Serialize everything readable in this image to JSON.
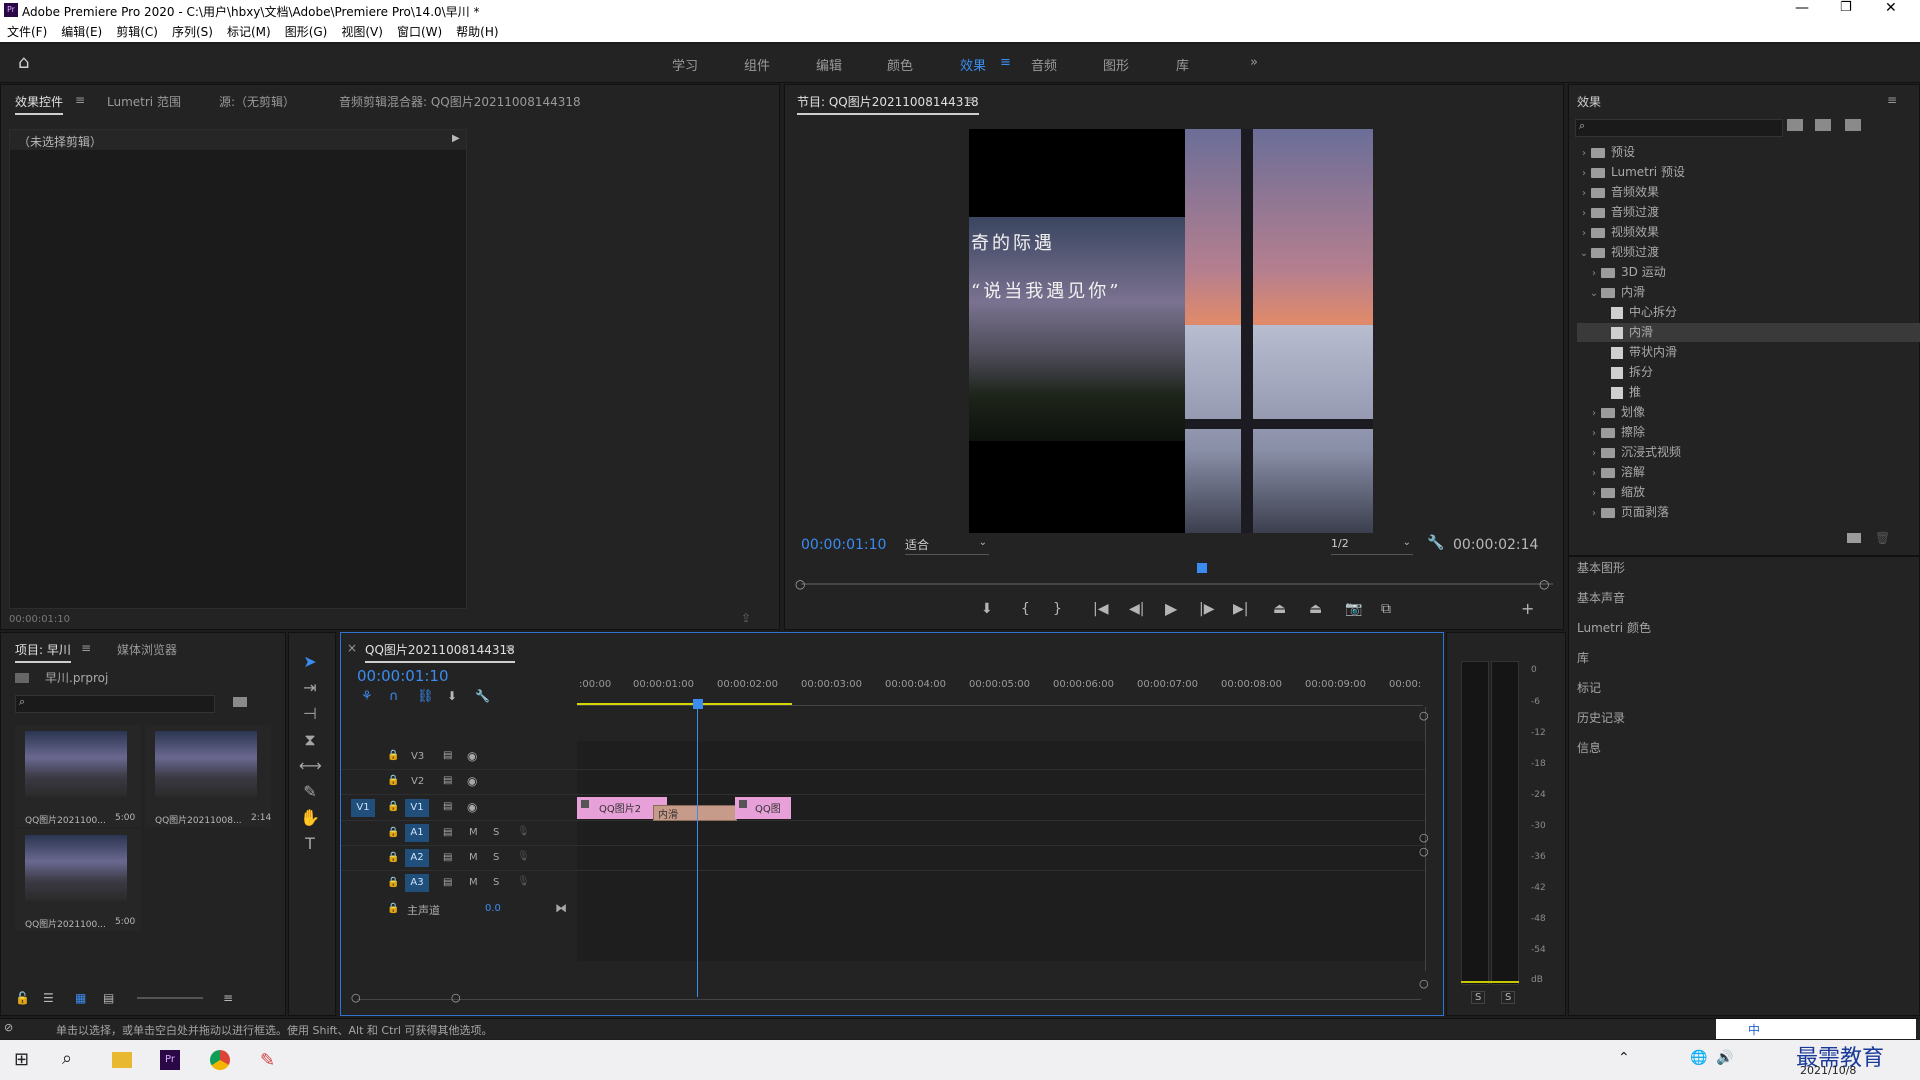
{
  "window": {
    "title": "Adobe Premiere Pro 2020 - C:\\用户\\hbxy\\文档\\Adobe\\Premiere Pro\\14.0\\早川 *"
  },
  "menu": [
    "文件(F)",
    "编辑(E)",
    "剪辑(C)",
    "序列(S)",
    "标记(M)",
    "图形(G)",
    "视图(V)",
    "窗口(W)",
    "帮助(H)"
  ],
  "workspaces": [
    {
      "label": "学习"
    },
    {
      "label": "组件"
    },
    {
      "label": "编辑"
    },
    {
      "label": "颜色"
    },
    {
      "label": "效果",
      "active": true
    },
    {
      "label": "音频"
    },
    {
      "label": "图形"
    },
    {
      "label": "库"
    }
  ],
  "top_left_panel": {
    "tabs": [
      "效果控件",
      "Lumetri 范围",
      "源:（无剪辑）",
      "音频剪辑混合器: QQ图片20211008144318"
    ],
    "no_clip": "（未选择剪辑）",
    "timecode": "00:00:01:10"
  },
  "program": {
    "title": "节目: QQ图片20211008144318",
    "overlay_line1": "奇的际遇",
    "overlay_line2": "“说当我遇见你”",
    "timecode": "00:00:01:10",
    "fit": "适合",
    "quality": "1/2",
    "duration": "00:00:02:14"
  },
  "effects": {
    "title": "效果",
    "tree": [
      {
        "label": "预设",
        "type": "folder",
        "level": 0,
        "open": false
      },
      {
        "label": "Lumetri 预设",
        "type": "folder",
        "level": 0,
        "open": false
      },
      {
        "label": "音频效果",
        "type": "folder",
        "level": 0,
        "open": false
      },
      {
        "label": "音频过渡",
        "type": "folder",
        "level": 0,
        "open": false
      },
      {
        "label": "视频效果",
        "type": "folder",
        "level": 0,
        "open": false
      },
      {
        "label": "视频过渡",
        "type": "folder",
        "level": 0,
        "open": true
      },
      {
        "label": "3D 运动",
        "type": "folder",
        "level": 1,
        "open": false
      },
      {
        "label": "内滑",
        "type": "folder",
        "level": 1,
        "open": true
      },
      {
        "label": "中心拆分",
        "type": "fx",
        "level": 2
      },
      {
        "label": "内滑",
        "type": "fx",
        "level": 2,
        "selected": true
      },
      {
        "label": "带状内滑",
        "type": "fx",
        "level": 2
      },
      {
        "label": "拆分",
        "type": "fx",
        "level": 2
      },
      {
        "label": "推",
        "type": "fx",
        "level": 2
      },
      {
        "label": "划像",
        "type": "folder",
        "level": 1,
        "open": false
      },
      {
        "label": "擦除",
        "type": "folder",
        "level": 1,
        "open": false
      },
      {
        "label": "沉浸式视频",
        "type": "folder",
        "level": 1,
        "open": false
      },
      {
        "label": "溶解",
        "type": "folder",
        "level": 1,
        "open": false
      },
      {
        "label": "缩放",
        "type": "folder",
        "level": 1,
        "open": false
      },
      {
        "label": "页面剥落",
        "type": "folder",
        "level": 1,
        "open": false
      }
    ],
    "side_panels": [
      "基本图形",
      "基本声音",
      "Lumetri 颜色",
      "库",
      "标记",
      "历史记录",
      "信息"
    ]
  },
  "project": {
    "tabs": [
      "项目: 早川",
      "媒体浏览器"
    ],
    "file": "早川.prproj",
    "items": [
      {
        "name": "QQ图片2021100...",
        "duration": "5:00"
      },
      {
        "name": "QQ图片20211008...",
        "duration": "2:14"
      },
      {
        "name": "QQ图片2021100...",
        "duration": "5:00"
      }
    ]
  },
  "timeline": {
    "title": "QQ图片20211008144318",
    "timecode": "00:00:01:10",
    "ruler": [
      ":00:00",
      "00:00:01:00",
      "00:00:02:00",
      "00:00:03:00",
      "00:00:04:00",
      "00:00:05:00",
      "00:00:06:00",
      "00:00:07:00",
      "00:00:08:00",
      "00:00:09:00",
      "00:00:"
    ],
    "video_tracks": [
      "V3",
      "V2",
      "V1"
    ],
    "audio_tracks": [
      "A1",
      "A2",
      "A3"
    ],
    "source_patch": "V1",
    "master_label": "主声道",
    "master_value": "0.0",
    "clip1": "QQ图片2",
    "transition": "内滑",
    "clip2": "QQ图",
    "mute": "M",
    "solo": "S"
  },
  "meter": {
    "labels": [
      "0",
      "-6",
      "-12",
      "-18",
      "-24",
      "-30",
      "-36",
      "-42",
      "-48",
      "-54",
      "dB"
    ],
    "solo": [
      "S",
      "S"
    ]
  },
  "status": "单击以选择，或单击空白处并拖动以进行框选。使用 Shift、Alt 和 Ctrl 可获得其他选项。",
  "taskbar": {
    "date": "2021/10/8",
    "watermark": "最需教育",
    "ime": "中"
  }
}
